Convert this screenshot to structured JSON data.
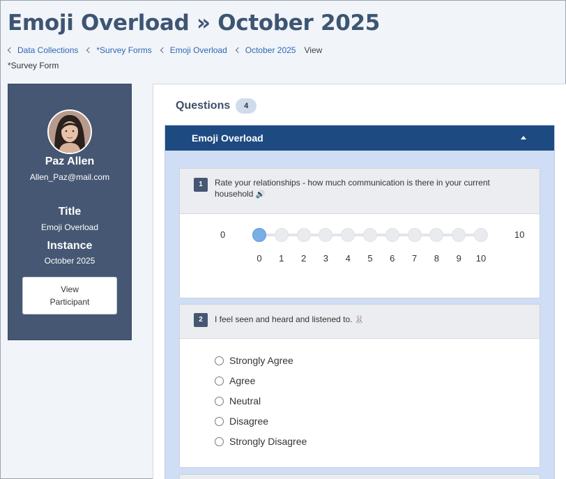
{
  "page": {
    "title": "Emoji Overload » October 2025",
    "subtitle": "*Survey Form"
  },
  "breadcrumb": {
    "items": [
      "Data Collections",
      "*Survey Forms",
      "Emoji Overload",
      "October 2025"
    ],
    "current": "View"
  },
  "profile": {
    "name": "Paz Allen",
    "email": "Allen_Paz@mail.com",
    "title_label": "Title",
    "title_value": "Emoji Overload",
    "instance_label": "Instance",
    "instance_value": "October 2025",
    "view_button_line1": "View",
    "view_button_line2": "Participant"
  },
  "questions": {
    "heading": "Questions",
    "count": "4",
    "section_title": "Emoji Overload",
    "q1": {
      "number": "1",
      "text": "Rate your relationships - how much communication is there in your current household",
      "emoji": "🔊",
      "min_label": "0",
      "max_label": "10",
      "ticks": [
        "0",
        "1",
        "2",
        "3",
        "4",
        "5",
        "6",
        "7",
        "8",
        "9",
        "10"
      ],
      "selected_value": 0
    },
    "q2": {
      "number": "2",
      "text": "I feel seen and heard and listened to.",
      "emoji": "🐰",
      "options": [
        "Strongly Agree",
        "Agree",
        "Neutral",
        "Disagree",
        "Strongly Disagree"
      ]
    }
  },
  "colors": {
    "header_blue": "#1e4a82",
    "card_slate": "#455772",
    "section_bg": "#cfdef5",
    "link": "#2d68b5",
    "selected_dot": "#7aaee6"
  }
}
